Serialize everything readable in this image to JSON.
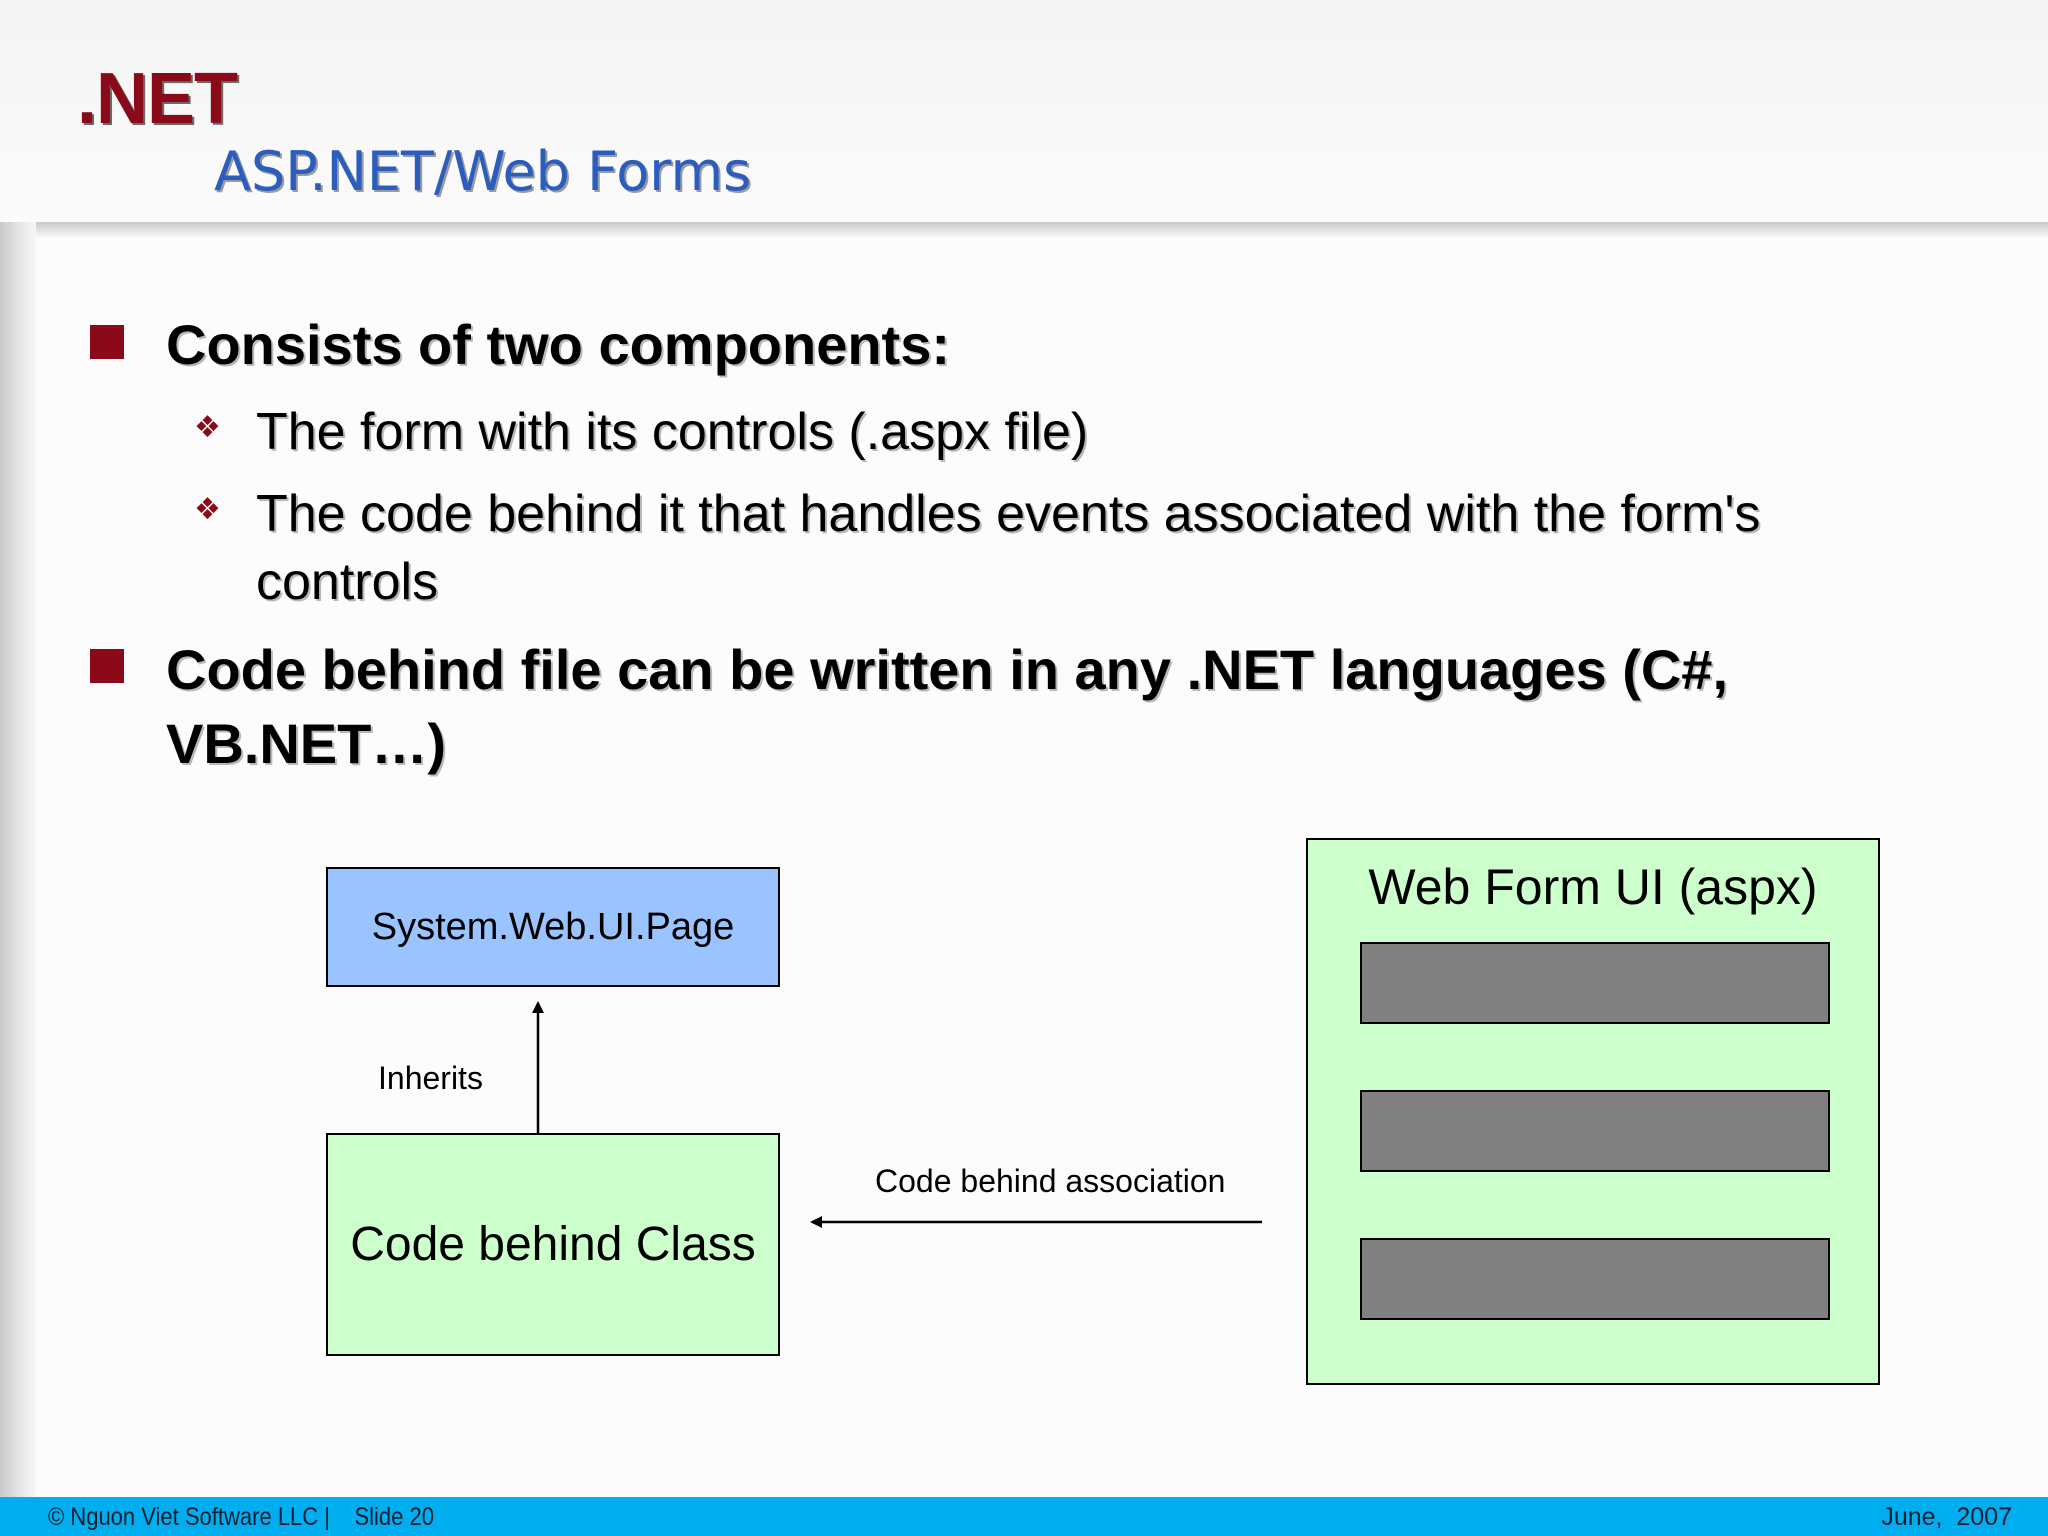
{
  "header": {
    "logo": ".NET",
    "title": "ASP.NET/Web Forms"
  },
  "bullets": [
    {
      "text": "Consists of two components:",
      "sub": [
        "The form with its controls (.aspx file)",
        "The code behind it that handles events associated with the form's",
        "controls"
      ]
    },
    {
      "text_line1": "Code behind file can be written in any .NET languages (C#,",
      "text_line2": "VB.NET…)"
    }
  ],
  "diagram": {
    "page_class": "System.Web.UI.Page",
    "inherits_label": "Inherits",
    "code_behind_class": "Code behind Class",
    "association_label": "Code behind association",
    "web_form_title": "Web Form UI (aspx)"
  },
  "footer": {
    "left": "© Nguon Viet Software LLC |    Slide 20",
    "right": "June,  2007"
  },
  "colors": {
    "logo": "#8b0a1a",
    "title": "#2a5dbd",
    "bullet": "#8b0a1a",
    "page_box": "#99c4ff",
    "green_box": "#ccffcc",
    "control": "#808080",
    "footer": "#00aeef"
  }
}
